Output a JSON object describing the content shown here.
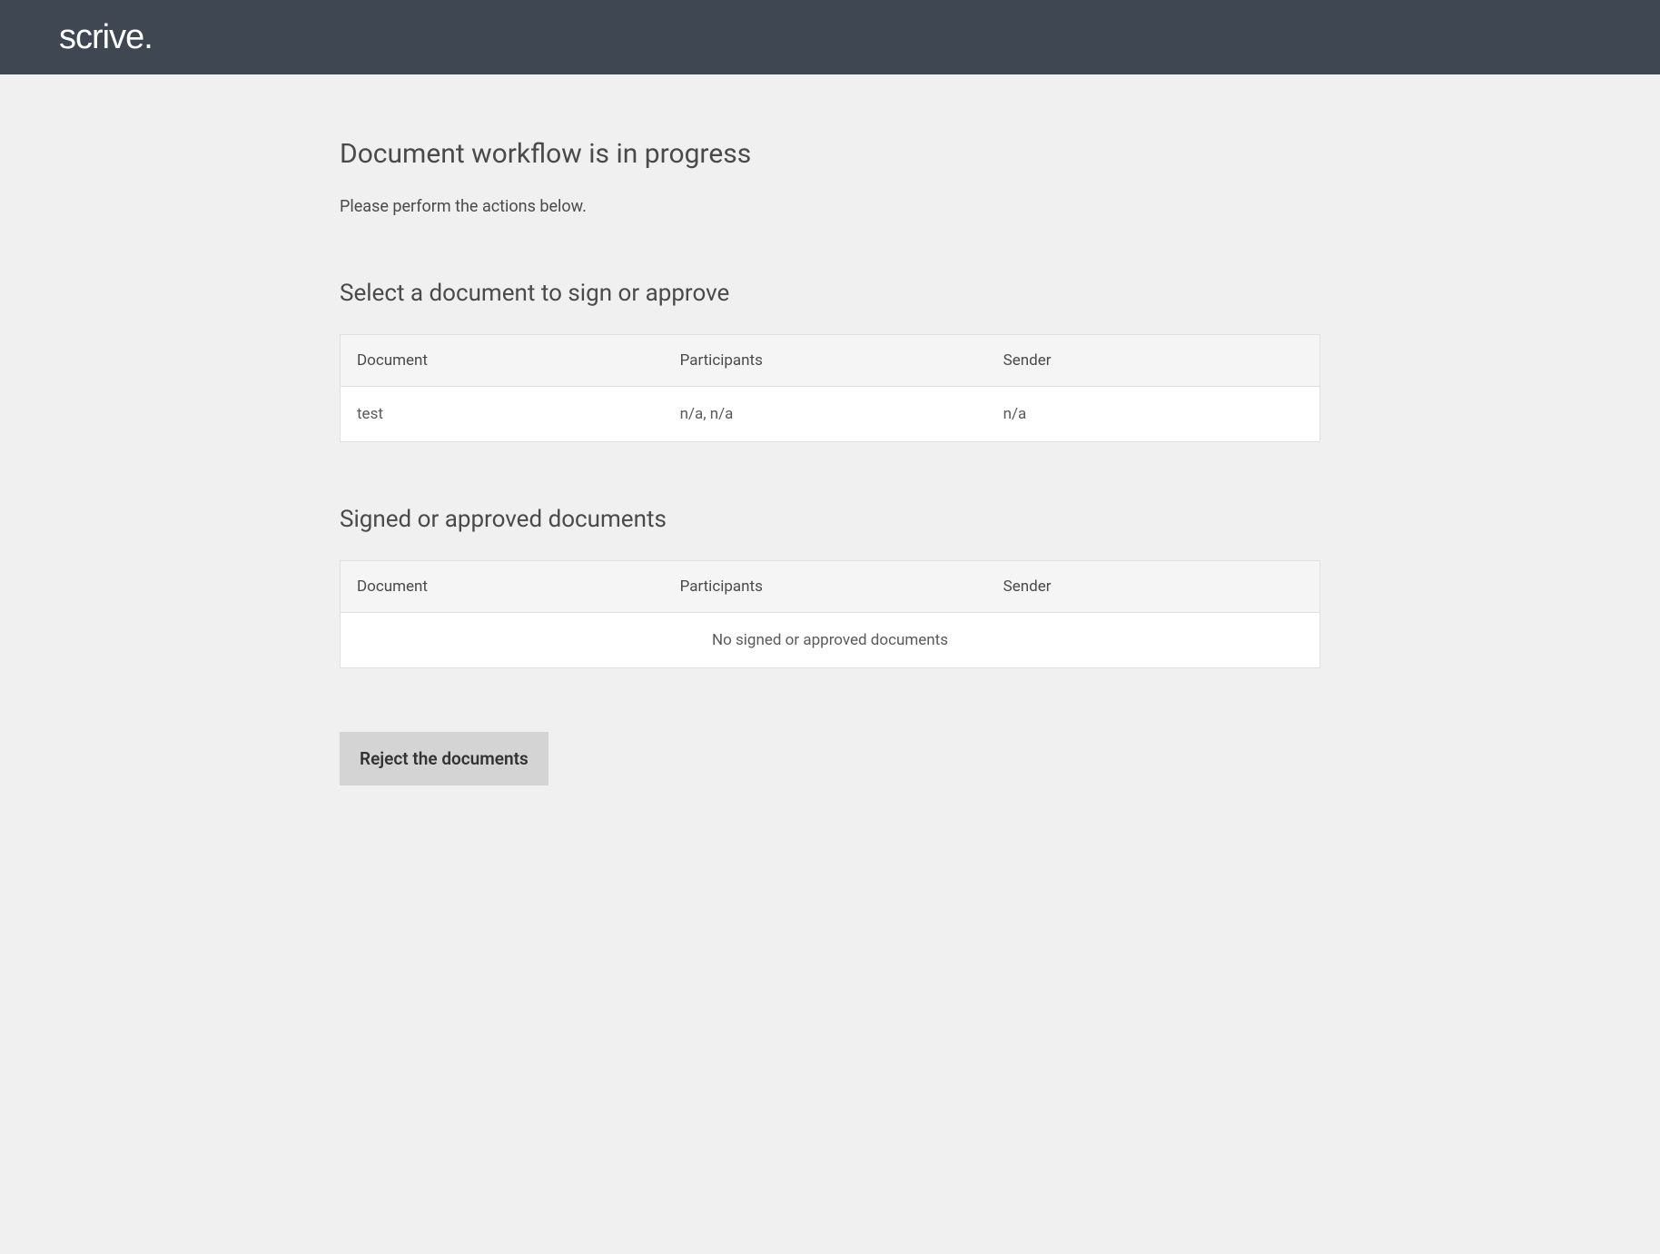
{
  "header": {
    "logo_text": "scrive."
  },
  "page": {
    "title": "Document workflow is in progress",
    "subtitle": "Please perform the actions below."
  },
  "sections": {
    "to_sign": {
      "title": "Select a document to sign or approve",
      "columns": {
        "document": "Document",
        "participants": "Participants",
        "sender": "Sender"
      },
      "rows": [
        {
          "document": "test",
          "participants": "n/a, n/a",
          "sender": "n/a"
        }
      ]
    },
    "signed": {
      "title": "Signed or approved documents",
      "columns": {
        "document": "Document",
        "participants": "Participants",
        "sender": "Sender"
      },
      "empty_message": "No signed or approved documents"
    }
  },
  "actions": {
    "reject_label": "Reject the documents"
  }
}
